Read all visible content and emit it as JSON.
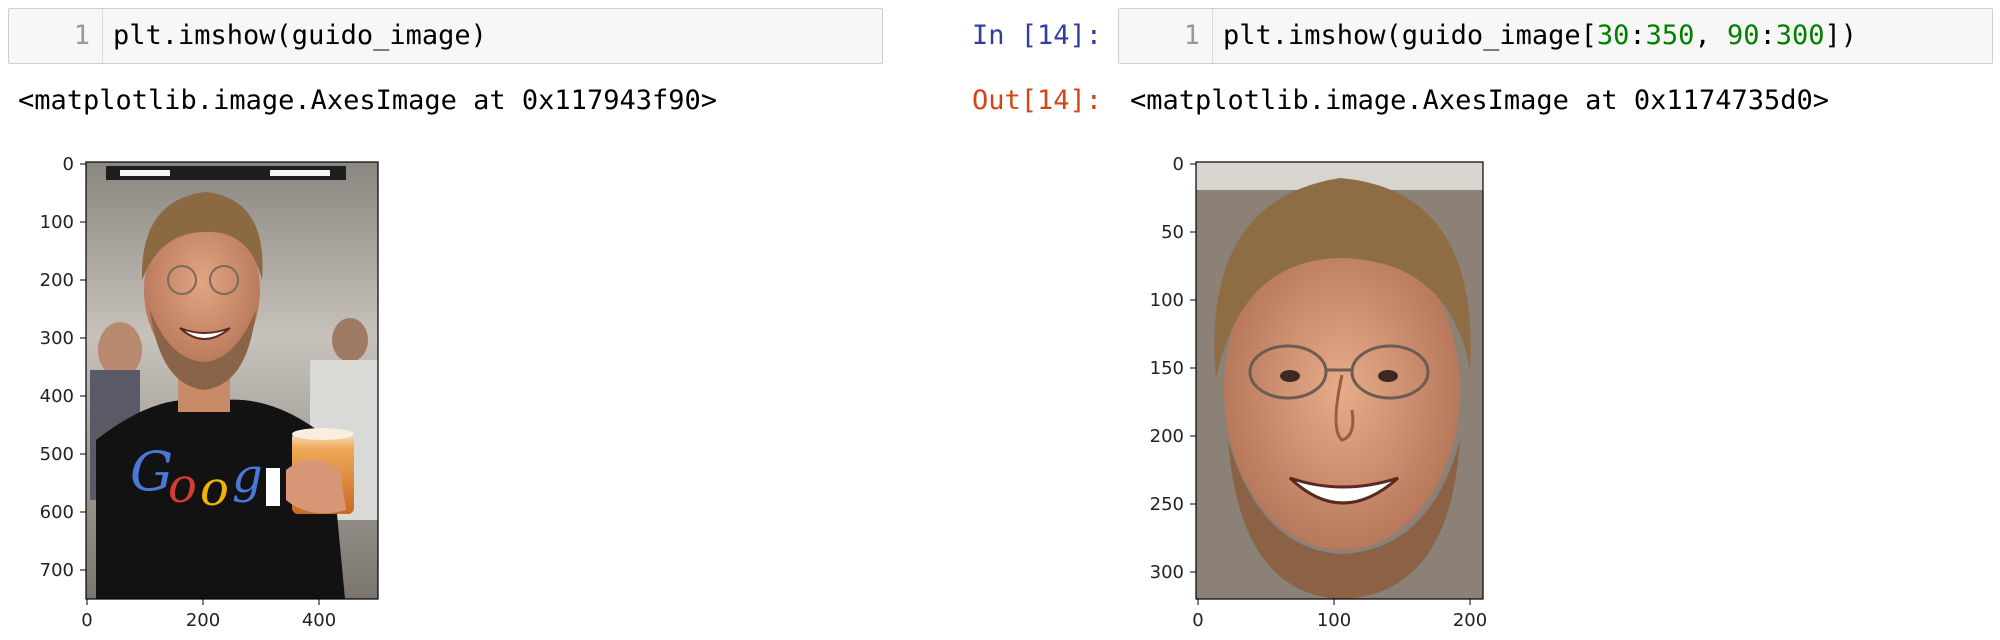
{
  "left_cell": {
    "line_number": "1",
    "code": "plt.imshow(guido_image)",
    "output": "<matplotlib.image.AxesImage at 0x117943f90>",
    "plot": {
      "image": "guido-full-photo",
      "y_ticks": [
        "0",
        "100",
        "200",
        "300",
        "400",
        "500",
        "600",
        "700"
      ],
      "x_ticks": [
        "0",
        "200",
        "400"
      ]
    }
  },
  "right_cell": {
    "in_prompt": "In [14]:",
    "line_number": "1",
    "code_prefix": "plt.imshow(guido_image[",
    "num1": "30",
    "colon1": ":",
    "num2": "350",
    "comma": ", ",
    "num3": "90",
    "colon2": ":",
    "num4": "300",
    "code_suffix": "])",
    "out_prompt": "Out[14]:",
    "output": "<matplotlib.image.AxesImage at 0x1174735d0>",
    "plot": {
      "image": "guido-face-crop",
      "y_ticks": [
        "0",
        "50",
        "100",
        "150",
        "200",
        "250",
        "300"
      ],
      "x_ticks": [
        "0",
        "100",
        "200"
      ]
    }
  },
  "colors": {
    "prompt_in": "#303f9f",
    "prompt_out": "#d84315",
    "number_literal": "#008000",
    "cell_background": "#f7f7f7"
  }
}
